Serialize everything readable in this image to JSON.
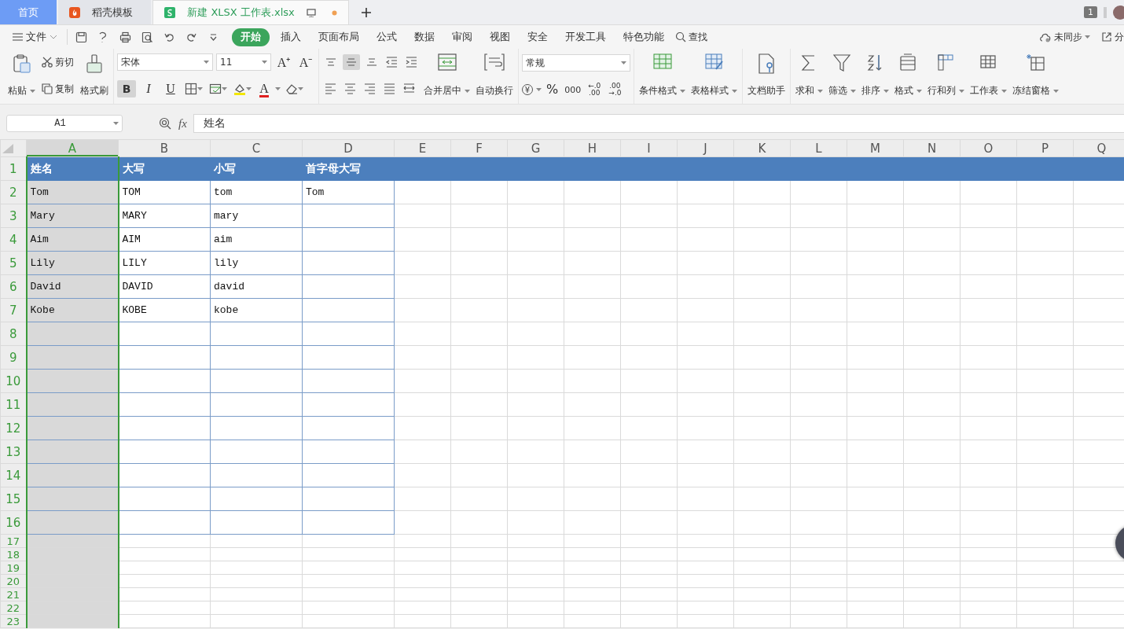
{
  "tabs": [
    {
      "label": "首页",
      "kind": "home",
      "selected": false
    },
    {
      "label": "稻壳模板",
      "kind": "docer",
      "selected": false
    },
    {
      "label": "新建 XLSX 工作表.xlsx",
      "kind": "sheet",
      "selected": true,
      "unsaved": true
    }
  ],
  "account_badge": "1",
  "menu": {
    "file": "文件",
    "items": [
      {
        "label": "开始",
        "selected": true
      },
      {
        "label": "插入",
        "selected": false
      },
      {
        "label": "页面布局",
        "selected": false
      },
      {
        "label": "公式",
        "selected": false
      },
      {
        "label": "数据",
        "selected": false
      },
      {
        "label": "审阅",
        "selected": false
      },
      {
        "label": "视图",
        "selected": false
      },
      {
        "label": "安全",
        "selected": false
      },
      {
        "label": "开发工具",
        "selected": false
      },
      {
        "label": "特色功能",
        "selected": false
      }
    ],
    "search": "查找",
    "sync": "未同步",
    "share": "分"
  },
  "ribbon": {
    "clipboard": {
      "paste": "粘贴",
      "cut": "剪切",
      "copy": "复制",
      "format_painter": "格式刷"
    },
    "font": {
      "name": "宋体",
      "size": "11",
      "grow": "A⁺",
      "shrink": "A⁻",
      "color_button": "A",
      "styles": [
        {
          "label": "B",
          "kind": "bold",
          "selected": true
        },
        {
          "label": "I",
          "kind": "italic",
          "selected": false
        },
        {
          "label": "U",
          "kind": "underline",
          "selected": false
        }
      ]
    },
    "alignment": {
      "vertical": [
        {
          "kind": "top",
          "selected": false
        },
        {
          "kind": "middle",
          "selected": true
        },
        {
          "kind": "bottom",
          "selected": false
        }
      ],
      "merge": "合并居中",
      "wrap": "自动换行"
    },
    "number": {
      "format": "常规",
      "currency": "¥",
      "percent": "%",
      "thousands": "000",
      "increase_decimal": [
        "←.0",
        ".00"
      ],
      "decrease_decimal": [
        ".00",
        "→.0"
      ]
    },
    "styles": {
      "conditional": "条件格式",
      "table_style": "表格样式"
    },
    "assistant": "文档助手",
    "tools": [
      "求和",
      "筛选",
      "排序",
      "格式",
      "行和列",
      "工作表",
      "冻结窗格"
    ]
  },
  "formula_bar": {
    "name_box": "A1",
    "fx": "fx",
    "value": "姓名"
  },
  "sheet": {
    "columns": [
      {
        "label": "A",
        "selected": true
      },
      {
        "label": "B",
        "selected": false
      },
      {
        "label": "C",
        "selected": false
      },
      {
        "label": "D",
        "selected": false
      },
      {
        "label": "E",
        "selected": false
      },
      {
        "label": "F",
        "selected": false
      },
      {
        "label": "G",
        "selected": false
      },
      {
        "label": "H",
        "selected": false
      },
      {
        "label": "I",
        "selected": false
      },
      {
        "label": "J",
        "selected": false
      },
      {
        "label": "K",
        "selected": false
      },
      {
        "label": "L",
        "selected": false
      },
      {
        "label": "M",
        "selected": false
      },
      {
        "label": "N",
        "selected": false
      },
      {
        "label": "O",
        "selected": false
      },
      {
        "label": "P",
        "selected": false
      },
      {
        "label": "Q",
        "selected": false
      }
    ],
    "rows": [
      {
        "number": "1",
        "kind": "header",
        "cells": [
          "姓名",
          "大写",
          "小写",
          "首字母大写"
        ]
      },
      {
        "number": "2",
        "kind": "body",
        "cells": [
          "Tom",
          "TOM",
          "tom",
          "Tom"
        ]
      },
      {
        "number": "3",
        "kind": "body",
        "cells": [
          "Mary",
          "MARY",
          "mary"
        ]
      },
      {
        "number": "4",
        "kind": "body",
        "cells": [
          "Aim",
          "AIM",
          "aim"
        ]
      },
      {
        "number": "5",
        "kind": "body",
        "cells": [
          "Lily",
          "LILY",
          "lily"
        ]
      },
      {
        "number": "6",
        "kind": "body",
        "cells": [
          "David",
          "DAVID",
          "david"
        ]
      },
      {
        "number": "7",
        "kind": "body",
        "cells": [
          "Kobe",
          "KOBE",
          "kobe"
        ]
      },
      {
        "number": "8",
        "kind": "body",
        "cells": []
      },
      {
        "number": "9",
        "kind": "body",
        "cells": []
      },
      {
        "number": "10",
        "kind": "body",
        "cells": []
      },
      {
        "number": "11",
        "kind": "body",
        "cells": []
      },
      {
        "number": "12",
        "kind": "body",
        "cells": []
      },
      {
        "number": "13",
        "kind": "body",
        "cells": []
      },
      {
        "number": "14",
        "kind": "body",
        "cells": []
      },
      {
        "number": "15",
        "kind": "body",
        "cells": []
      },
      {
        "number": "16",
        "kind": "body",
        "cells": []
      },
      {
        "number": "17",
        "kind": "plain",
        "cells": []
      },
      {
        "number": "18",
        "kind": "plain",
        "cells": []
      },
      {
        "number": "19",
        "kind": "plain",
        "cells": []
      },
      {
        "number": "20",
        "kind": "plain",
        "cells": []
      },
      {
        "number": "21",
        "kind": "plain",
        "cells": []
      },
      {
        "number": "22",
        "kind": "plain",
        "cells": []
      },
      {
        "number": "23",
        "kind": "plain",
        "cells": []
      }
    ]
  }
}
